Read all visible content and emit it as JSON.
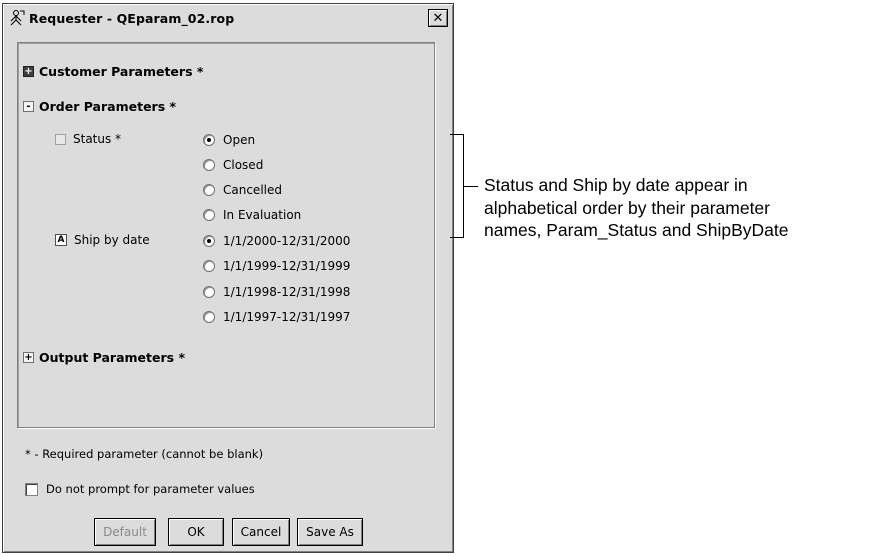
{
  "window": {
    "title": "Requester - QEparam_02.rop",
    "close_icon": "close-icon",
    "title_icon": "requester-icon"
  },
  "groups": {
    "customer": {
      "label": "Customer Parameters *",
      "state": "collapsed"
    },
    "order": {
      "label": "Order Parameters *",
      "state": "expanded"
    },
    "output": {
      "label": "Output Parameters *",
      "state": "collapsed"
    }
  },
  "params": {
    "status": {
      "label": "Status *",
      "options": [
        "Open",
        "Closed",
        "Cancelled",
        "In Evaluation"
      ],
      "selected": "Open"
    },
    "ship_by_date": {
      "label": "Ship by date",
      "options": [
        "1/1/2000-12/31/2000",
        "1/1/1999-12/31/1999",
        "1/1/1998-12/31/1998",
        "1/1/1997-12/31/1997"
      ],
      "selected": "1/1/2000-12/31/2000"
    }
  },
  "footer": {
    "required_note": "* - Required parameter (cannot be blank)",
    "no_prompt_label": "Do not prompt for parameter values",
    "no_prompt_checked": false
  },
  "buttons": {
    "default_label": "Default",
    "ok_label": "OK",
    "cancel_label": "Cancel",
    "save_as_label": "Save As"
  },
  "annotation": {
    "lines": [
      "Status and Ship by date appear in",
      "alphabetical order by their parameter",
      "names, Param_Status and ShipByDate"
    ]
  }
}
